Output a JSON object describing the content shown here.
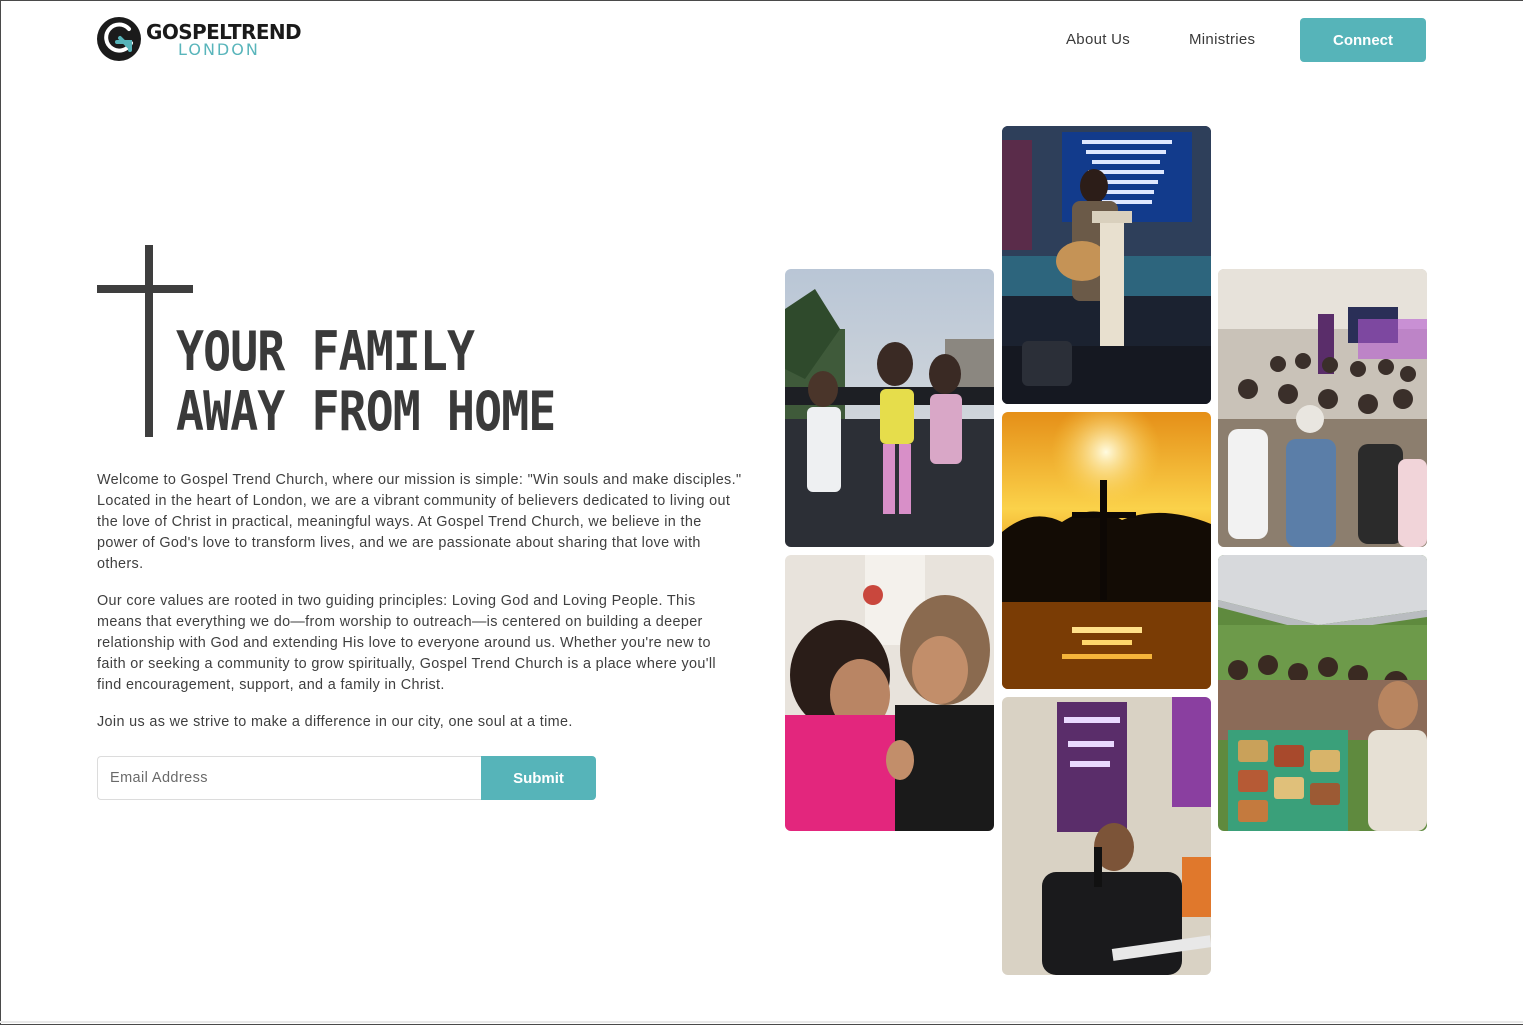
{
  "brand": {
    "name": "GOSPELTREND",
    "city": "LONDON",
    "accent": "#56b4b9"
  },
  "nav": {
    "about": "About Us",
    "ministries": "Ministries",
    "connect": "Connect"
  },
  "hero": {
    "title_line1": "YOUR FAMILY",
    "title_line2": "AWAY FROM HOME",
    "paragraph1": "Welcome to Gospel Trend Church, where our mission is simple: \"Win souls and make disciples.\" Located in the heart of London, we are a vibrant community of believers dedicated to living out the love of Christ in practical, meaningful ways. At Gospel Trend Church, we believe in the power of God's love to transform lives, and we are passionate about sharing that love with others.",
    "paragraph2": "Our core values are rooted in two guiding principles: Loving God and Loving People. This means that everything we do—from worship to outreach—is centered on building a deeper relationship with God and extending His love to everyone around us. Whether you're new to faith or seeking a community to grow spiritually, Gospel Trend Church is a place where you'll find encouragement, support, and a family in Christ.",
    "paragraph3": "Join us as we strive to make a difference in our city, one soul at a time."
  },
  "signup": {
    "email_placeholder": "Email Address",
    "email_value": "",
    "submit": "Submit"
  },
  "icons": {
    "logo": "circular-arrow-g-logo-icon",
    "cross": "cross-icon"
  }
}
